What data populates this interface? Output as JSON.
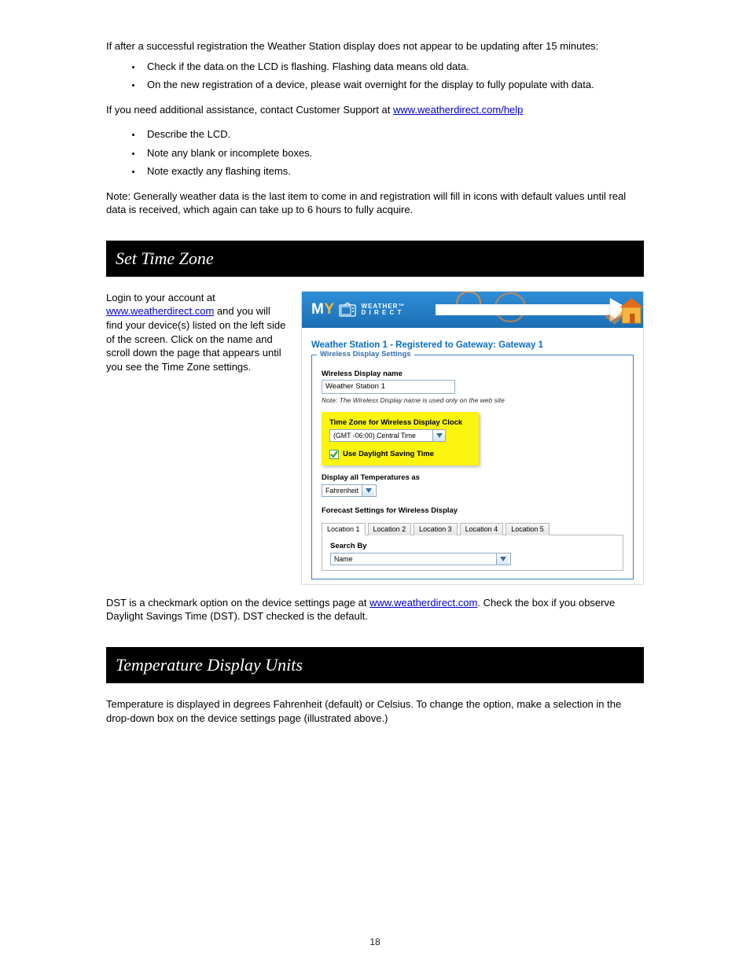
{
  "intro": "If after a successful registration the Weather Station display does not appear to be updating after 15 minutes:",
  "bullets_a": [
    "Check if the data on the LCD is flashing. Flashing data means old data.",
    "On the new registration of a device, please wait overnight for the display to fully populate with data."
  ],
  "help_line_pre": "If you need additional assistance, contact Customer Support at ",
  "help_link": "www.weatherdirect.com/help",
  "bullets_b": [
    "Describe the LCD.",
    "Note any blank or incomplete boxes.",
    "Note exactly any flashing items."
  ],
  "note_para": "Note:  Generally weather data is the last item to come in and registration will fill in icons with default values until real data is received, which again can take up to 6 hours to fully acquire.",
  "heading_tz": "Set Time Zone",
  "tz_left_pre": "Login to your account at ",
  "tz_left_link": "www.weatherdirect.com",
  "tz_left_post": " and you will find your device(s) listed on the left side of the screen.  Click on the name and scroll down the page that appears until you see the Time Zone settings.",
  "shot": {
    "title": "Weather Station 1 - Registered to Gateway: Gateway 1",
    "legend": "Wireless Display Settings",
    "name_label": "Wireless Display name",
    "name_value": "Weather Station 1",
    "name_note": "Note: The Wireless Display name is used only on the web site",
    "tz_label": "Time Zone for Wireless Display Clock",
    "tz_value": "(GMT -06:00) Central Time",
    "dst_label": "Use Daylight Saving Time",
    "temp_label": "Display all Temperatures as",
    "temp_value": "Fahrenheit",
    "forecast_label": "Forecast Settings for Wireless Display",
    "tabs": [
      "Location 1",
      "Location 2",
      "Location 3",
      "Location 4",
      "Location 5"
    ],
    "search_label": "Search By",
    "search_value": "Name",
    "brand": {
      "my_m": "M",
      "my_y": "Y",
      "line1": "WEATHER™",
      "line2": "D I R E C T"
    }
  },
  "dst_para_pre": "DST is a checkmark option on the device settings page at ",
  "dst_link": "www.weatherdirect.com",
  "dst_para_post": ".  Check the box if you observe Daylight Savings Time (DST).  DST checked is the default.",
  "heading_temp": "Temperature Display Units",
  "temp_para": "Temperature is displayed in degrees Fahrenheit (default) or Celsius.  To change the option, make a selection in the drop-down box on the device settings page (illustrated above.)",
  "page_num": "18"
}
